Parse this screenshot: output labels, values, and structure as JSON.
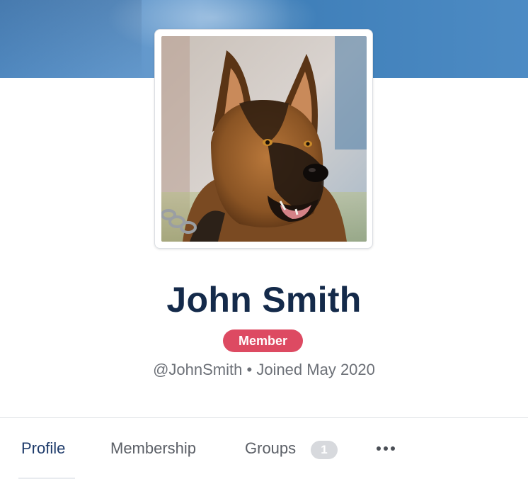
{
  "profile": {
    "name": "John Smith",
    "role_badge": "Member",
    "handle": "@JohnSmith",
    "separator": "•",
    "joined": "Joined May 2020",
    "avatar_description": "avatar-photo-german-shepherd"
  },
  "tabs": [
    {
      "label": "Profile",
      "active": true
    },
    {
      "label": "Membership",
      "active": false
    },
    {
      "label": "Groups",
      "active": false,
      "count": "1"
    }
  ],
  "more_icon": "more-horizontal-icon",
  "colors": {
    "cover": "#5088bf",
    "name": "#142a4a",
    "badge": "#dd4a62",
    "meta": "#6c7077",
    "active_tab": "#1d3a6a",
    "count_badge": "#d7d9dd"
  }
}
